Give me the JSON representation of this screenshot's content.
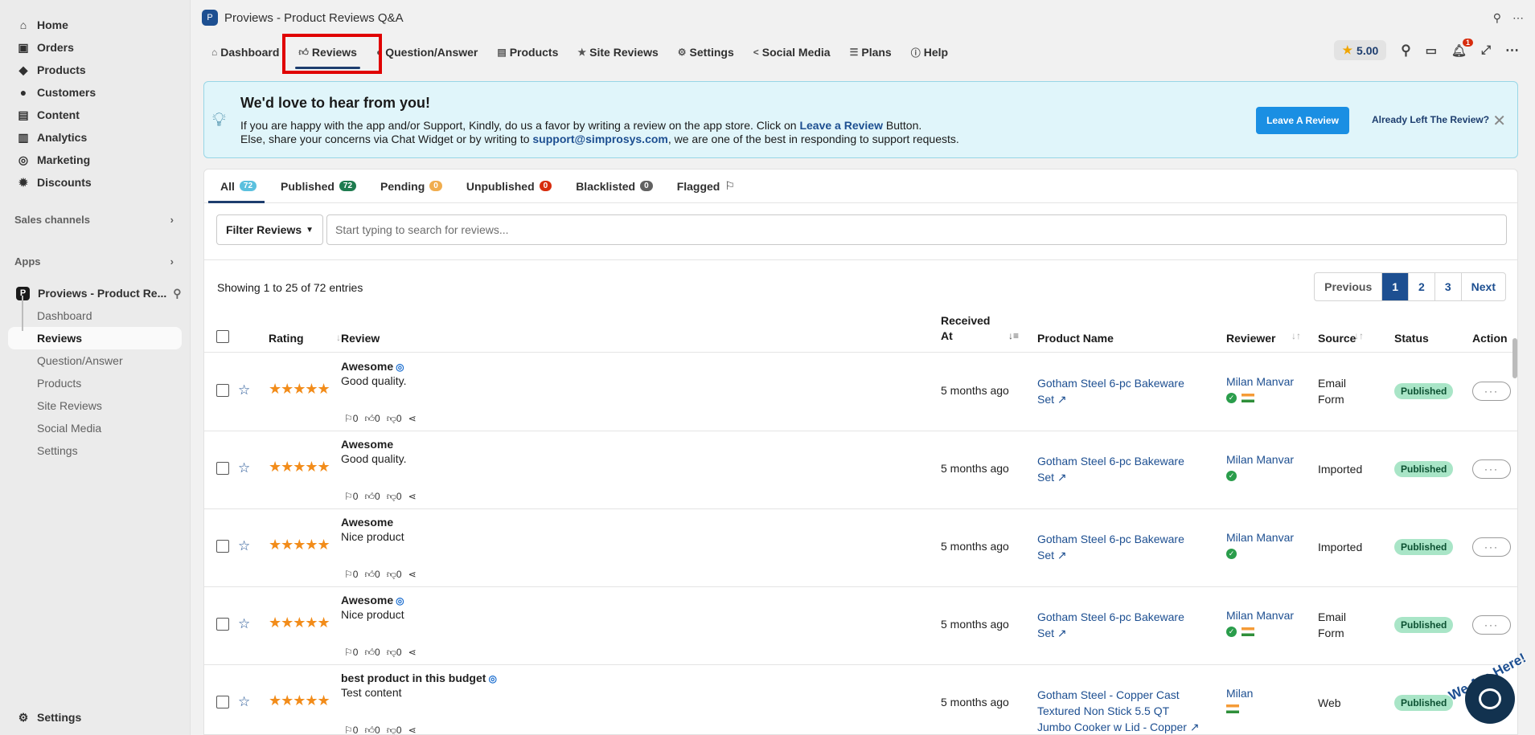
{
  "sidebar": {
    "nav": [
      {
        "label": "Home",
        "icon": "home-icon"
      },
      {
        "label": "Orders",
        "icon": "orders-icon"
      },
      {
        "label": "Products",
        "icon": "tag-icon"
      },
      {
        "label": "Customers",
        "icon": "person-icon"
      },
      {
        "label": "Content",
        "icon": "document-icon"
      },
      {
        "label": "Analytics",
        "icon": "bar-chart-icon"
      },
      {
        "label": "Marketing",
        "icon": "target-icon"
      },
      {
        "label": "Discounts",
        "icon": "discount-icon"
      }
    ],
    "sales_channels": "Sales channels",
    "apps": "Apps",
    "app_name": "Proviews - Product Re...",
    "app_sub": [
      "Dashboard",
      "Reviews",
      "Question/Answer",
      "Products",
      "Site Reviews",
      "Social Media",
      "Settings"
    ],
    "settings": "Settings"
  },
  "header": {
    "title": "Proviews - Product Reviews Q&A"
  },
  "tabs": [
    {
      "label": "Dashboard",
      "icon": "home-icon"
    },
    {
      "label": "Reviews",
      "icon": "thumbs-up-icon"
    },
    {
      "label": "Question/Answer",
      "icon": "question-icon"
    },
    {
      "label": "Products",
      "icon": "list-icon"
    },
    {
      "label": "Site Reviews",
      "icon": "star-icon"
    },
    {
      "label": "Settings",
      "icon": "gear-icon"
    },
    {
      "label": "Social Media",
      "icon": "share-icon"
    },
    {
      "label": "Plans",
      "icon": "list-icon"
    },
    {
      "label": "Help",
      "icon": "info-icon"
    }
  ],
  "toolbar": {
    "rating": "5.00",
    "notification_count": "1"
  },
  "banner": {
    "title": "We'd love to hear from you!",
    "line1_a": "If you are happy with the app and/or Support, Kindly, do us a favor by writing a review on the app store. Click on ",
    "line1_link": "Leave a Review",
    "line1_b": " Button.",
    "line2_a": "Else, share your concerns via Chat Widget or by writing to ",
    "line2_link": "support@simprosys.com",
    "line2_b": ", we are one of the best in responding to support requests.",
    "btn_leave": "Leave A Review",
    "btn_already": "Already Left The Review?"
  },
  "status_tabs": [
    {
      "label": "All",
      "count": "72",
      "color": "#5bc0de"
    },
    {
      "label": "Published",
      "count": "72",
      "color": "#1e7b4f"
    },
    {
      "label": "Pending",
      "count": "0",
      "color": "#f0ad4e"
    },
    {
      "label": "Unpublished",
      "count": "0",
      "color": "#d72c0d"
    },
    {
      "label": "Blacklisted",
      "count": "0",
      "color": "#616161"
    },
    {
      "label": "Flagged",
      "count": "",
      "color": ""
    }
  ],
  "filter": {
    "button": "Filter Reviews",
    "placeholder": "Start typing to search for reviews..."
  },
  "entries": "Showing 1 to 25 of 72 entries",
  "pager": {
    "prev": "Previous",
    "pages": [
      "1",
      "2",
      "3"
    ],
    "next": "Next"
  },
  "columns": {
    "rating": "Rating",
    "review": "Review",
    "received_1": "Received",
    "received_2": "At",
    "product": "Product Name",
    "reviewer": "Reviewer",
    "source": "Source",
    "status": "Status",
    "action": "Action"
  },
  "rows": [
    {
      "title": "Awesome",
      "verified": true,
      "body": "Good quality.",
      "flags": "0",
      "likes": "0",
      "dislikes": "0",
      "received": "5 months ago",
      "product": "Gotham Steel 6-pc Bakeware Set",
      "reviewer": "Milan Manvar",
      "rev_verified": true,
      "flag": true,
      "source": "Email Form",
      "status": "Published"
    },
    {
      "title": "Awesome",
      "verified": false,
      "body": "Good quality.",
      "flags": "0",
      "likes": "0",
      "dislikes": "0",
      "received": "5 months ago",
      "product": "Gotham Steel 6-pc Bakeware Set",
      "reviewer": "Milan Manvar",
      "rev_verified": true,
      "flag": false,
      "source": "Imported",
      "status": "Published"
    },
    {
      "title": "Awesome",
      "verified": false,
      "body": "Nice product",
      "flags": "0",
      "likes": "0",
      "dislikes": "0",
      "received": "5 months ago",
      "product": "Gotham Steel 6-pc Bakeware Set",
      "reviewer": "Milan Manvar",
      "rev_verified": true,
      "flag": false,
      "source": "Imported",
      "status": "Published"
    },
    {
      "title": "Awesome",
      "verified": true,
      "body": "Nice product",
      "flags": "0",
      "likes": "0",
      "dislikes": "0",
      "received": "5 months ago",
      "product": "Gotham Steel 6-pc Bakeware Set",
      "reviewer": "Milan Manvar",
      "rev_verified": true,
      "flag": true,
      "source": "Email Form",
      "status": "Published"
    },
    {
      "title": "best product in this budget",
      "verified": true,
      "body": "Test content",
      "flags": "0",
      "likes": "0",
      "dislikes": "0",
      "received": "5 months ago",
      "product": "Gotham Steel - Copper Cast Textured Non Stick 5.5 QT Jumbo Cooker w Lid - Copper",
      "reviewer": "Milan",
      "rev_verified": false,
      "flag": true,
      "source": "Web",
      "status": "Published"
    }
  ],
  "chat": {
    "label": "We Are Here!"
  }
}
